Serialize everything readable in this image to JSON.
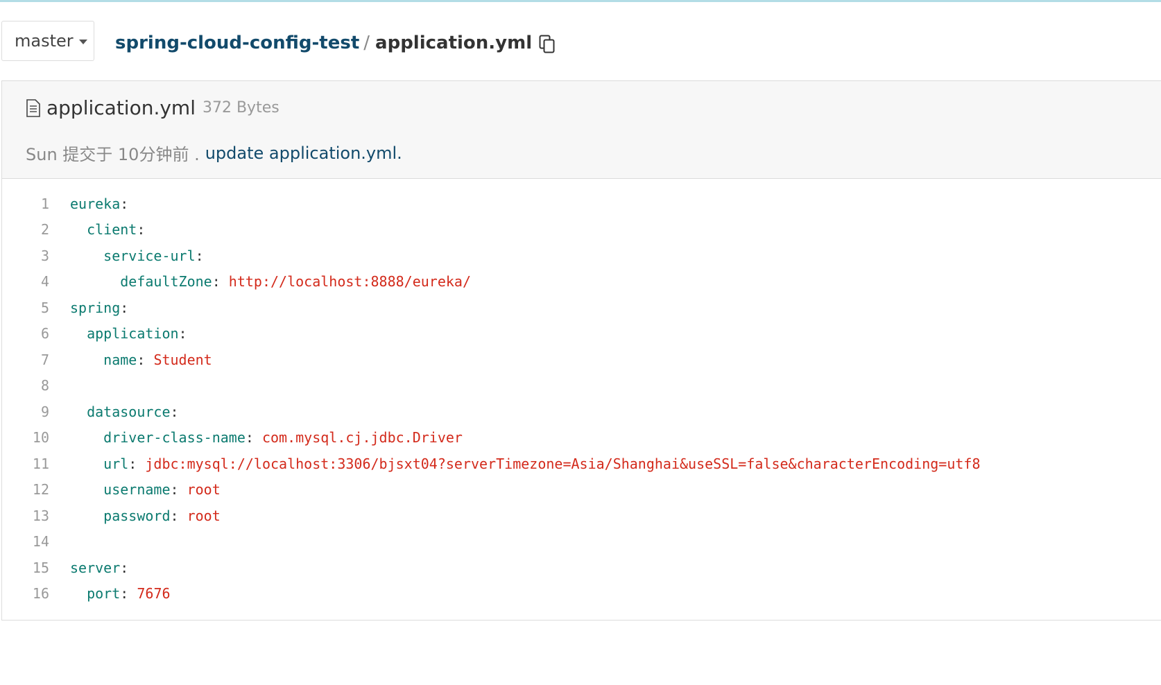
{
  "branch": {
    "label": "master"
  },
  "breadcrumb": {
    "repo": "spring-cloud-config-test",
    "separator": "/",
    "file": "application.yml"
  },
  "file": {
    "name": "application.yml",
    "size": "372 Bytes",
    "commit": {
      "meta": "Sun 提交于 10分钟前 .",
      "message": "update application.yml."
    }
  },
  "code_lines": [
    {
      "num": "1",
      "indent": "",
      "key": "eureka",
      "sep": ":",
      "value": ""
    },
    {
      "num": "2",
      "indent": "  ",
      "key": "client",
      "sep": ":",
      "value": ""
    },
    {
      "num": "3",
      "indent": "    ",
      "key": "service-url",
      "sep": ":",
      "value": ""
    },
    {
      "num": "4",
      "indent": "      ",
      "key": "defaultZone",
      "sep": ": ",
      "value": "http://localhost:8888/eureka/"
    },
    {
      "num": "5",
      "indent": "",
      "key": "spring",
      "sep": ":",
      "value": ""
    },
    {
      "num": "6",
      "indent": "  ",
      "key": "application",
      "sep": ":",
      "value": ""
    },
    {
      "num": "7",
      "indent": "    ",
      "key": "name",
      "sep": ": ",
      "value": "Student"
    },
    {
      "num": "8",
      "indent": "",
      "key": "",
      "sep": "",
      "value": ""
    },
    {
      "num": "9",
      "indent": "  ",
      "key": "datasource",
      "sep": ":",
      "value": ""
    },
    {
      "num": "10",
      "indent": "    ",
      "key": "driver-class-name",
      "sep": ": ",
      "value": "com.mysql.cj.jdbc.Driver"
    },
    {
      "num": "11",
      "indent": "    ",
      "key": "url",
      "sep": ": ",
      "value": "jdbc:mysql://localhost:3306/bjsxt04?serverTimezone=Asia/Shanghai&useSSL=false&characterEncoding=utf8"
    },
    {
      "num": "12",
      "indent": "    ",
      "key": "username",
      "sep": ": ",
      "value": "root"
    },
    {
      "num": "13",
      "indent": "    ",
      "key": "password",
      "sep": ": ",
      "value": "root"
    },
    {
      "num": "14",
      "indent": "",
      "key": "",
      "sep": "",
      "value": ""
    },
    {
      "num": "15",
      "indent": "",
      "key": "server",
      "sep": ":",
      "value": ""
    },
    {
      "num": "16",
      "indent": "  ",
      "key": "port",
      "sep": ": ",
      "value": "7676"
    }
  ],
  "colors": {
    "key": "#0b7a6f",
    "value": "#d32a1b",
    "link": "#124a6b",
    "line_number": "#999999"
  },
  "icons": {
    "branch_caret": "caret-down-icon",
    "copy": "copy-icon",
    "file": "file-document-icon"
  }
}
